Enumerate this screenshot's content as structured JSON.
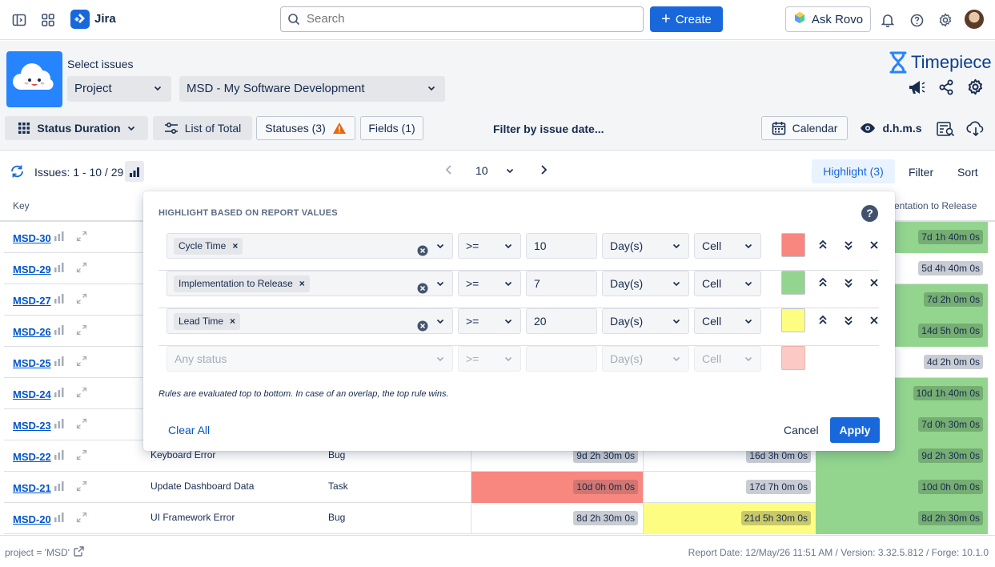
{
  "topnav": {
    "app_name": "Jira",
    "search_placeholder": "Search",
    "create_label": "Create",
    "rovo_label": "Ask Rovo"
  },
  "appbar": {
    "select_issues_label": "Select issues",
    "scope_select": "Project",
    "project_select": "MSD - My Software Development",
    "brand_name": "Timepiece",
    "report_type": "Status Duration",
    "list_label": "List of Total",
    "statuses_label": "Statuses (3)",
    "fields_label": "Fields (1)",
    "filter_date_label": "Filter by issue date...",
    "calendar_label": "Calendar",
    "time_format_label": "d.h.m.s"
  },
  "toolbar": {
    "issues_range": "Issues: 1 - 10 / 29",
    "page_size": "10",
    "highlight_label": "Highlight (3)",
    "filter_label": "Filter",
    "sort_label": "Sort"
  },
  "table": {
    "headers": {
      "key": "Key",
      "col3_partial": "entation to Release"
    },
    "rows": [
      {
        "key": "MSD-30",
        "summary": "",
        "type": "",
        "c1": "",
        "c2": "",
        "c3": "7d 1h 40m 0s"
      },
      {
        "key": "MSD-29",
        "summary": "",
        "type": "",
        "c1": "",
        "c2": "",
        "c3": "5d 4h 40m 0s"
      },
      {
        "key": "MSD-27",
        "summary": "",
        "type": "",
        "c1": "",
        "c2": "",
        "c3": "7d 2h 0m 0s"
      },
      {
        "key": "MSD-26",
        "summary": "",
        "type": "",
        "c1": "",
        "c2": "",
        "c3": "14d 5h 0m 0s"
      },
      {
        "key": "MSD-25",
        "summary": "",
        "type": "",
        "c1": "",
        "c2": "",
        "c3": "4d 2h 0m 0s"
      },
      {
        "key": "MSD-24",
        "summary": "",
        "type": "",
        "c1": "",
        "c2": "",
        "c3": "10d 1h 40m 0s"
      },
      {
        "key": "MSD-23",
        "summary": "",
        "type": "",
        "c1": "",
        "c2": "",
        "c3": "7d 0h 30m 0s"
      },
      {
        "key": "MSD-22",
        "summary": "Keyboard Error",
        "type": "Bug",
        "c1": "9d 2h 30m 0s",
        "c2": "16d 3h 0m 0s",
        "c3": "9d 2h 30m 0s"
      },
      {
        "key": "MSD-21",
        "summary": "Update Dashboard Data",
        "type": "Task",
        "c1": "10d 0h 0m 0s",
        "c2": "17d 7h 0m 0s",
        "c3": "10d 0h 0m 0s"
      },
      {
        "key": "MSD-20",
        "summary": "UI Framework Error",
        "type": "Bug",
        "c1": "8d 2h 30m 0s",
        "c2": "21d 5h 30m 0s",
        "c3": "8d 2h 30m 0s"
      }
    ]
  },
  "highlight_popup": {
    "title": "HIGHLIGHT BASED ON REPORT VALUES",
    "rules": [
      {
        "status": "Cycle Time",
        "operator": ">=",
        "value": "10",
        "unit": "Day(s)",
        "target": "Cell",
        "color": "#f8877f"
      },
      {
        "status": "Implementation to Release",
        "operator": ">=",
        "value": "7",
        "unit": "Day(s)",
        "target": "Cell",
        "color": "#93d58f"
      },
      {
        "status": "Lead Time",
        "operator": ">=",
        "value": "20",
        "unit": "Day(s)",
        "target": "Cell",
        "color": "#fdfd82"
      }
    ],
    "new_rule": {
      "status_placeholder": "Any status",
      "operator": ">=",
      "unit": "Day(s)",
      "target": "Cell",
      "color": "#fcc9c4"
    },
    "note": "Rules are evaluated top to bottom. In case of an overlap, the top rule wins.",
    "clear_all_label": "Clear All",
    "cancel_label": "Cancel",
    "apply_label": "Apply"
  },
  "footer": {
    "jql": "project = 'MSD'",
    "report_info": "Report Date: 12/May/26 11:51 AM / Version: 3.32.5.812 / Forge: 10.1.0"
  },
  "colors": {
    "primary": "#1868db",
    "red_highlight": "#f8877f",
    "green_highlight": "#93d58f",
    "yellow_highlight": "#fdfd82",
    "value_chip": "#c9ccd2"
  }
}
